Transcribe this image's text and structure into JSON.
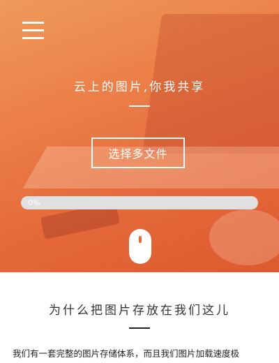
{
  "hero": {
    "title": "云上的图片,你我共享",
    "select_button_label": "选择多文件",
    "progress": {
      "label": "0%",
      "fraction": 0
    },
    "accent_color": "#ec7f48"
  },
  "icons": {
    "menu": "menu-icon",
    "scroll": "mouse-scroll-icon"
  },
  "section": {
    "title": "为什么把图片存放在我们这儿",
    "text": "我们有一套完整的图片存储体系，而且我们图片加载速度极"
  }
}
